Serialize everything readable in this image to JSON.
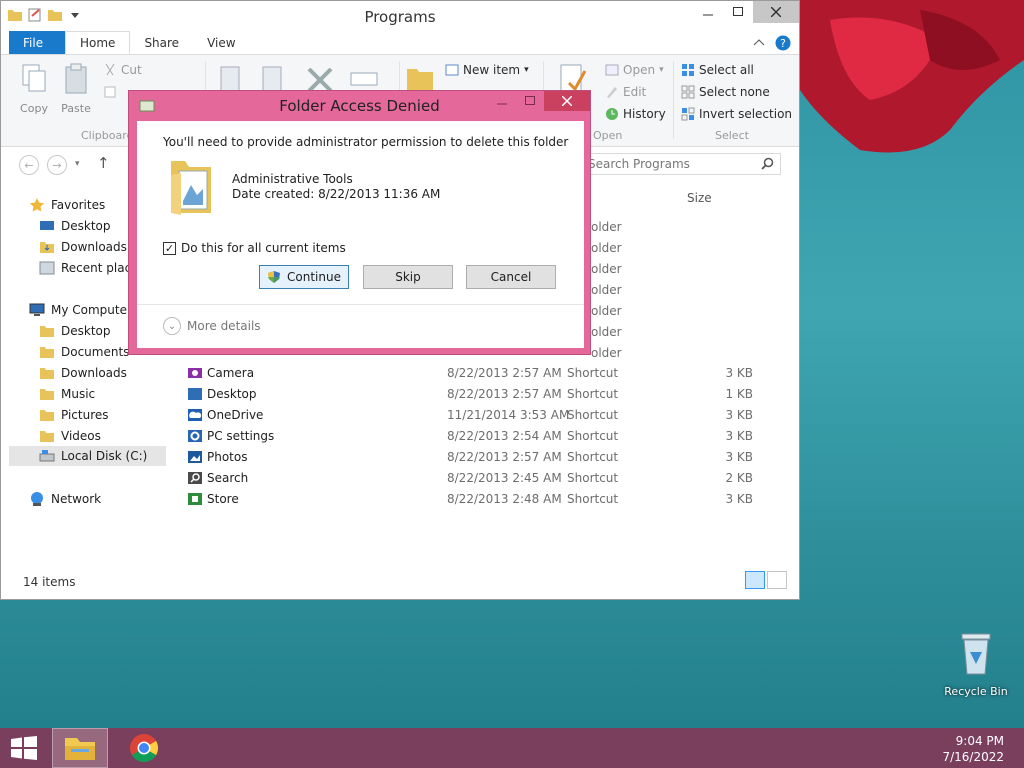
{
  "explorer": {
    "title": "Programs",
    "tabs": [
      "File",
      "Home",
      "Share",
      "View"
    ],
    "active_tab": "Home",
    "ribbon": {
      "copy": "Copy",
      "paste": "Paste",
      "cut": "Cut",
      "clipboard_group": "Clipboard",
      "new_item": "New item",
      "open": "Open",
      "edit": "Edit",
      "history": "History",
      "open_group": "Open",
      "select_all": "Select all",
      "select_none": "Select none",
      "invert_selection": "Invert selection",
      "select_group": "Select"
    },
    "search_placeholder": "Search Programs",
    "column_size": "Size",
    "nav": {
      "favorites": "Favorites",
      "fav_items": [
        "Desktop",
        "Downloads",
        "Recent places"
      ],
      "computer": "My Computer",
      "computer_items": [
        "Desktop",
        "Documents",
        "Downloads",
        "Music",
        "Pictures",
        "Videos",
        "Local Disk (C:)"
      ],
      "network": "Network"
    },
    "partial_type": "older",
    "files": [
      {
        "name": "Camera",
        "date": "8/22/2013 2:57 AM",
        "type": "Shortcut",
        "size": "3 KB"
      },
      {
        "name": "Desktop",
        "date": "8/22/2013 2:57 AM",
        "type": "Shortcut",
        "size": "1 KB"
      },
      {
        "name": "OneDrive",
        "date": "11/21/2014 3:53 AM",
        "type": "Shortcut",
        "size": "3 KB"
      },
      {
        "name": "PC settings",
        "date": "8/22/2013 2:54 AM",
        "type": "Shortcut",
        "size": "3 KB"
      },
      {
        "name": "Photos",
        "date": "8/22/2013 2:57 AM",
        "type": "Shortcut",
        "size": "3 KB"
      },
      {
        "name": "Search",
        "date": "8/22/2013 2:45 AM",
        "type": "Shortcut",
        "size": "2 KB"
      },
      {
        "name": "Store",
        "date": "8/22/2013 2:48 AM",
        "type": "Shortcut",
        "size": "3 KB"
      }
    ],
    "status": "14 items"
  },
  "dialog": {
    "title": "Folder Access Denied",
    "message": "You'll need to provide administrator permission to delete this folder",
    "folder_name": "Administrative Tools",
    "date_created": "Date created: 8/22/2013 11:36 AM",
    "checkbox_label": "Do this for all current items",
    "checkbox_checked": true,
    "continue_label": "Continue",
    "skip_label": "Skip",
    "cancel_label": "Cancel",
    "more_details": "More details"
  },
  "desktop": {
    "recycle_bin": "Recycle Bin"
  },
  "taskbar": {
    "time": "9:04 PM",
    "date": "7/16/2022"
  },
  "colors": {
    "dialog_frame": "#e4689a",
    "taskbar": "#7a3f5c",
    "accent": "#1979ca"
  }
}
